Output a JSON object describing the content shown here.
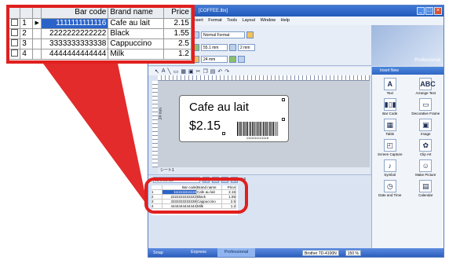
{
  "app": {
    "title": "[COFFEE.lbx]",
    "menu": [
      "Insert",
      "Format",
      "Tools",
      "Layout",
      "Window",
      "Help"
    ],
    "format_combo": "Normal Format",
    "size_combo_1": "55.1 mm",
    "size_combo_2": "24 mm",
    "size_combo_3": "2 mm",
    "brand_text": "Professional"
  },
  "label": {
    "name_text": "Cafe au lait",
    "price_text": "$2.15",
    "barcode_digits": "1111111111116",
    "dimension": "24 mm"
  },
  "sheet_tab": "シート1",
  "database_bar": {
    "filename": "coffee2.xls",
    "page": "1/4"
  },
  "insert_panel": {
    "header": "Insert New",
    "items": [
      {
        "label": "Text",
        "icon": "A"
      },
      {
        "label": "Arrange Text",
        "icon": "ABC"
      },
      {
        "label": "Bar Code",
        "icon": "▮▯▮"
      },
      {
        "label": "Decorative Frame",
        "icon": "▭"
      },
      {
        "label": "Table",
        "icon": "▦"
      },
      {
        "label": "Image",
        "icon": "▣"
      },
      {
        "label": "Screen Capture",
        "icon": "◰"
      },
      {
        "label": "Clip Art",
        "icon": "✿"
      },
      {
        "label": "Symbol",
        "icon": "♪"
      },
      {
        "label": "Make Picture",
        "icon": "☺"
      },
      {
        "label": "Date and Time",
        "icon": "◷"
      },
      {
        "label": "Calendar",
        "icon": "▤"
      }
    ]
  },
  "status": {
    "snap": "Snap",
    "modes": [
      "Express",
      "Professional"
    ],
    "active_mode": "Professional",
    "printer": "Brother TD-4100N",
    "zoom": "150 %"
  },
  "database": {
    "columns": [
      "Bar code",
      "Brand name",
      "Price"
    ],
    "rows": [
      {
        "num": "1",
        "barcode": "1111111111116",
        "brand": "Cafe au lait",
        "price": "2.15"
      },
      {
        "num": "2",
        "barcode": "2222222222222",
        "brand": "Black",
        "price": "1.55"
      },
      {
        "num": "3",
        "barcode": "3333333333338",
        "brand": "Cappuccino",
        "price": "2.5"
      },
      {
        "num": "4",
        "barcode": "4444444444444",
        "brand": "Milk",
        "price": "1.2"
      }
    ],
    "selected_row": 0
  },
  "colors": {
    "highlight": "#e0201f",
    "selection": "#2b63c9",
    "title_bar": "#2159b8"
  }
}
